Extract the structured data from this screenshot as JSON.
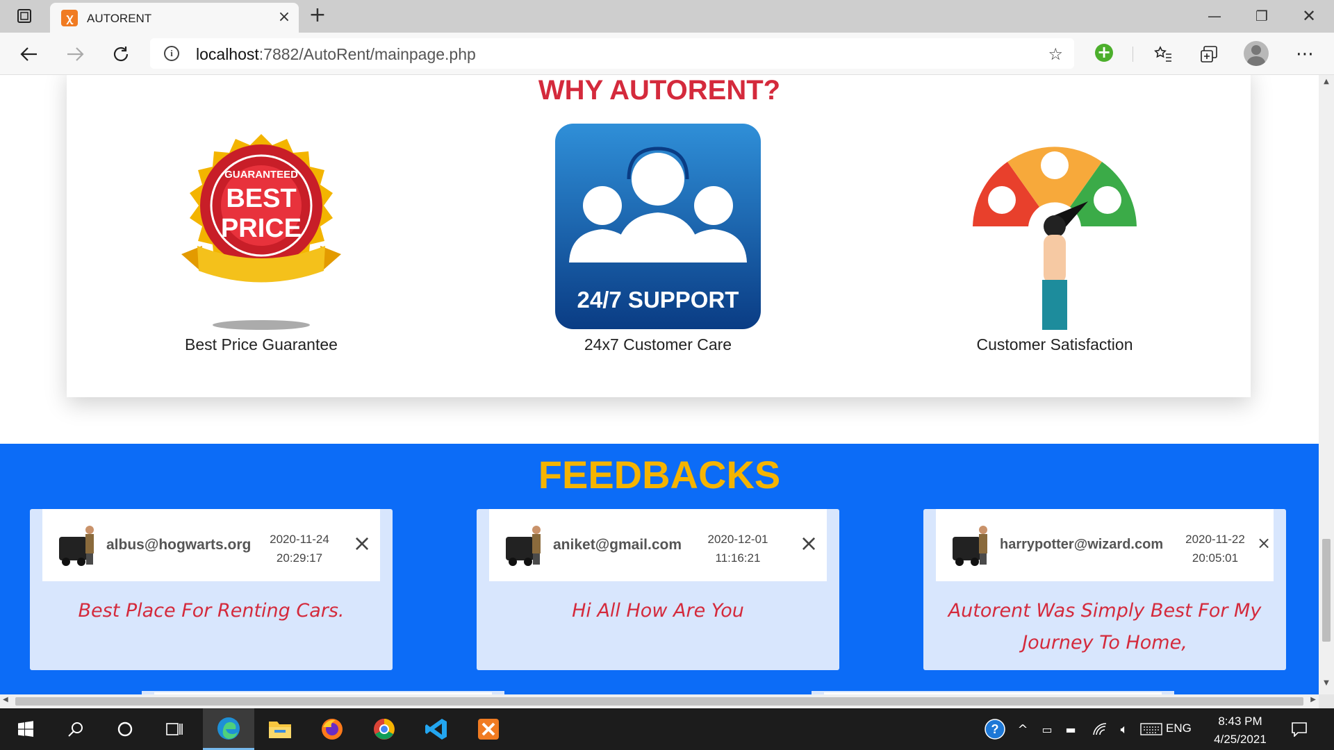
{
  "browser": {
    "tab_title": "AUTORENT",
    "tab_favicon": "xampp-icon",
    "url_host": "localhost",
    "url_rest": ":7882/AutoRent/mainpage.php"
  },
  "why": {
    "title": "WHY AUTORENT?",
    "features": [
      {
        "label": "Best Price Guarantee",
        "image": "best-price-badge",
        "badge_top": "GUARANTEED",
        "badge_line1": "BEST",
        "badge_line2": "PRICE"
      },
      {
        "label": "24x7 Customer Care",
        "image": "support-icon",
        "image_text": "24/7 SUPPORT"
      },
      {
        "label": "Customer Satisfaction",
        "image": "satisfaction-meter"
      }
    ]
  },
  "feedbacks": {
    "title": "FEEDBACKS",
    "items": [
      {
        "email": "albus@hogwarts.org",
        "date": "2020-11-24",
        "time": "20:29:17",
        "message": "Best Place For Renting Cars."
      },
      {
        "email": "aniket@gmail.com",
        "date": "2020-12-01",
        "time": "11:16:21",
        "message": "Hi All How Are You"
      },
      {
        "email": "harrypotter@wizard.com",
        "date": "2020-11-22",
        "time": "20:05:01",
        "message": "Autorent Was Simply Best For My Journey To Home,"
      }
    ]
  },
  "taskbar": {
    "apps": [
      "windows-start",
      "search",
      "cortana",
      "task-view",
      "edge",
      "file-explorer",
      "firefox",
      "chrome",
      "vscode",
      "xampp"
    ],
    "language": "ENG",
    "time": "8:43 PM",
    "date": "4/25/2021"
  },
  "colors": {
    "accent_red": "#d42a3c",
    "feedback_bg": "#0c6cf7",
    "feedback_title": "#f5b400",
    "card_bg": "#d8e6fd"
  }
}
